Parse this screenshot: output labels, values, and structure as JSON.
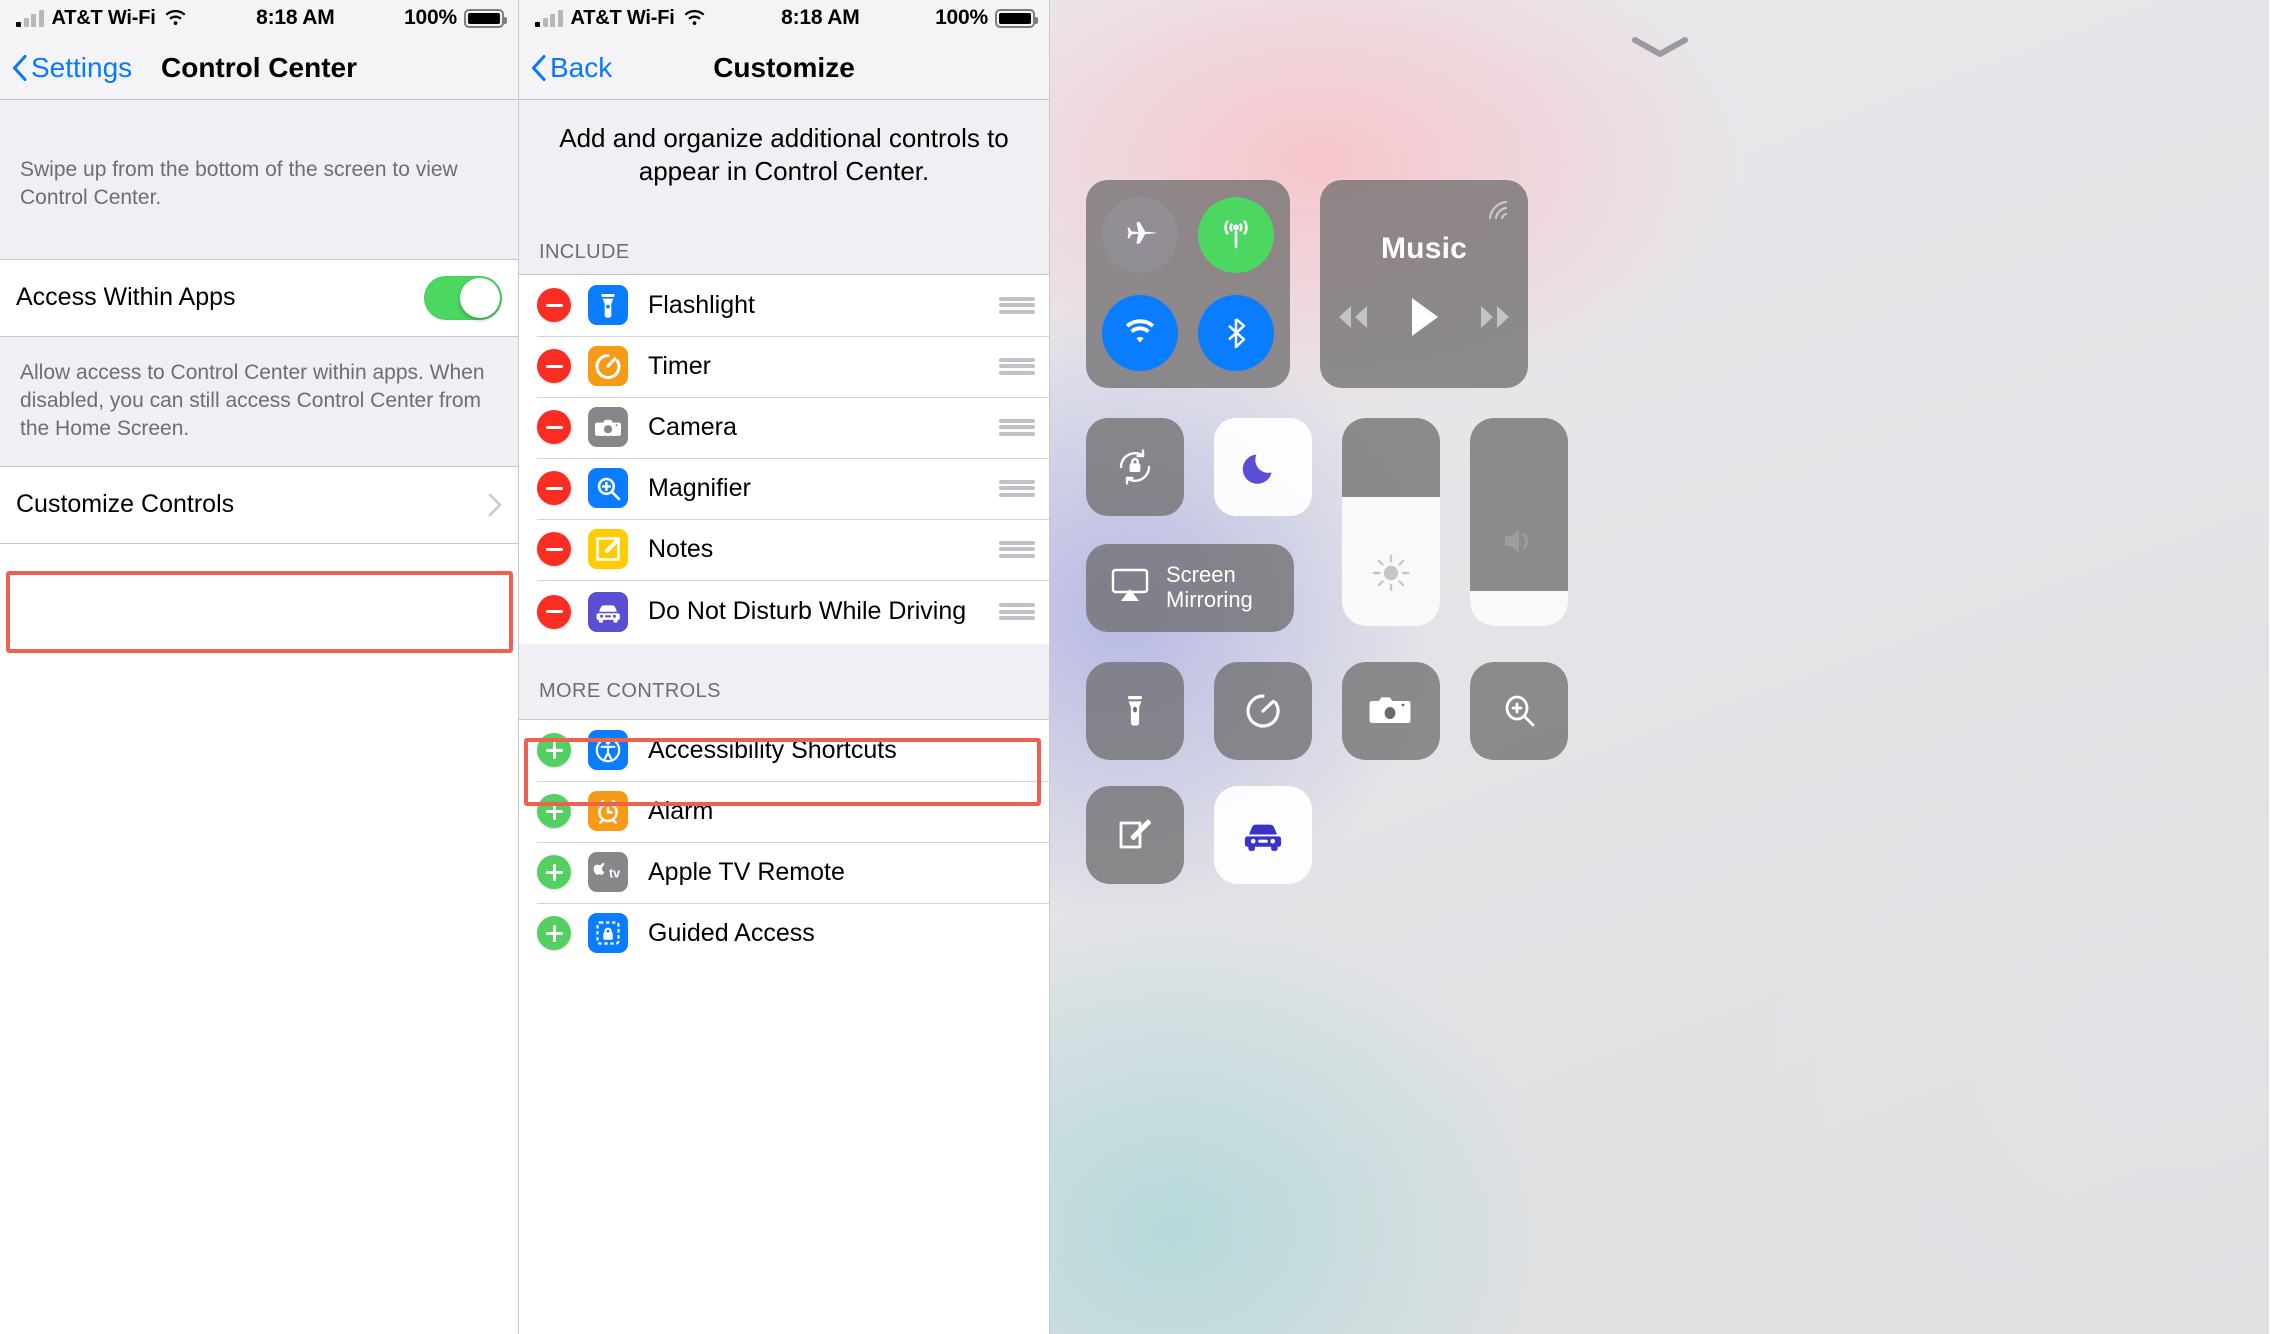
{
  "status_bar": {
    "carrier": "AT&T Wi-Fi",
    "time": "8:18 AM",
    "battery_percent": "100%",
    "signal_icon": "cellular-bars-icon",
    "wifi_icon": "wifi-icon",
    "battery_icon": "battery-full-icon"
  },
  "left_panel": {
    "nav": {
      "back_label": "Settings",
      "title": "Control Center"
    },
    "intro_footer": "Swipe up from the bottom of the screen to view Control Center.",
    "access_row": {
      "label": "Access Within Apps",
      "toggle_on": true
    },
    "access_footer": "Allow access to Control Center within apps. When disabled, you can still access Control Center from the Home Screen.",
    "customize_row": {
      "label": "Customize Controls",
      "chevron": "chevron-right-icon",
      "highlighted": true
    }
  },
  "middle_panel": {
    "nav": {
      "back_label": "Back",
      "title": "Customize"
    },
    "instruction": "Add and organize additional controls to appear in Control Center.",
    "include_header": "INCLUDE",
    "include_items": [
      {
        "label": "Flashlight",
        "icon": "flashlight-icon",
        "icon_bg": "#0a7cff",
        "action": "remove",
        "highlighted": false
      },
      {
        "label": "Timer",
        "icon": "timer-icon",
        "icon_bg": "#f79a16",
        "action": "remove",
        "highlighted": false
      },
      {
        "label": "Camera",
        "icon": "camera-icon",
        "icon_bg": "#86868b",
        "action": "remove",
        "highlighted": false
      },
      {
        "label": "Magnifier",
        "icon": "magnifier-icon",
        "icon_bg": "#0a7cff",
        "action": "remove",
        "highlighted": false
      },
      {
        "label": "Notes",
        "icon": "notes-icon",
        "icon_bg": "#ffcc00",
        "action": "remove",
        "highlighted": false
      },
      {
        "label": "Do Not Disturb While Driving",
        "icon": "car-icon",
        "icon_bg": "#5a4fd2",
        "action": "remove",
        "highlighted": true
      }
    ],
    "more_header": "MORE CONTROLS",
    "more_items": [
      {
        "label": "Accessibility Shortcuts",
        "icon": "accessibility-icon",
        "icon_bg": "#0a7cff",
        "action": "add"
      },
      {
        "label": "Alarm",
        "icon": "alarm-clock-icon",
        "icon_bg": "#f79a16",
        "action": "add"
      },
      {
        "label": "Apple TV Remote",
        "icon": "apple-tv-icon",
        "icon_bg": "#86868b",
        "action": "add"
      },
      {
        "label": "Guided Access",
        "icon": "guided-access-lock-icon",
        "icon_bg": "#0a7cff",
        "action": "add"
      }
    ]
  },
  "right_panel": {
    "handle_icon": "chevron-down-handle-icon",
    "connectivity": [
      {
        "name": "airplane-mode-toggle",
        "icon": "airplane-icon",
        "state": "off"
      },
      {
        "name": "cellular-data-toggle",
        "icon": "cellular-antenna-icon",
        "state": "on"
      },
      {
        "name": "wifi-toggle",
        "icon": "wifi-icon",
        "state": "on"
      },
      {
        "name": "bluetooth-toggle",
        "icon": "bluetooth-icon",
        "state": "on"
      }
    ],
    "music": {
      "title": "Music",
      "airplay_icon": "airplay-icon",
      "prev_icon": "rewind-icon",
      "play_icon": "play-icon",
      "next_icon": "fast-forward-icon"
    },
    "rotation_lock": {
      "name": "rotation-lock-toggle",
      "icon": "rotation-lock-icon",
      "state": "off"
    },
    "do_not_disturb": {
      "name": "do-not-disturb-toggle",
      "icon": "moon-icon",
      "state": "off"
    },
    "screen_mirroring": {
      "label": "Screen\nMirroring",
      "label_line1": "Screen",
      "label_line2": "Mirroring",
      "icon": "screen-mirroring-icon"
    },
    "brightness": {
      "name": "brightness-slider",
      "icon": "sun-icon",
      "value_percent": 62
    },
    "volume": {
      "name": "volume-slider",
      "icon": "speaker-icon",
      "value_percent": 17
    },
    "shortcuts": [
      {
        "name": "flashlight-button",
        "icon": "flashlight-icon",
        "state": "off"
      },
      {
        "name": "timer-button",
        "icon": "timer-icon",
        "state": "off"
      },
      {
        "name": "camera-button",
        "icon": "camera-icon",
        "state": "off"
      },
      {
        "name": "magnifier-button",
        "icon": "magnifier-icon",
        "state": "off"
      },
      {
        "name": "notes-button",
        "icon": "notes-icon",
        "state": "off"
      },
      {
        "name": "do-not-disturb-while-driving-button",
        "icon": "car-icon",
        "state": "on"
      }
    ],
    "annotation_arrow": {
      "icon": "left-arrow-annotation",
      "color": "#f0503c"
    }
  },
  "colors": {
    "accent_blue": "#077aff",
    "highlight_red": "#f0604e",
    "toggle_green": "#4cd662",
    "remove_red": "#fb2c22",
    "add_green": "#54cf62"
  }
}
